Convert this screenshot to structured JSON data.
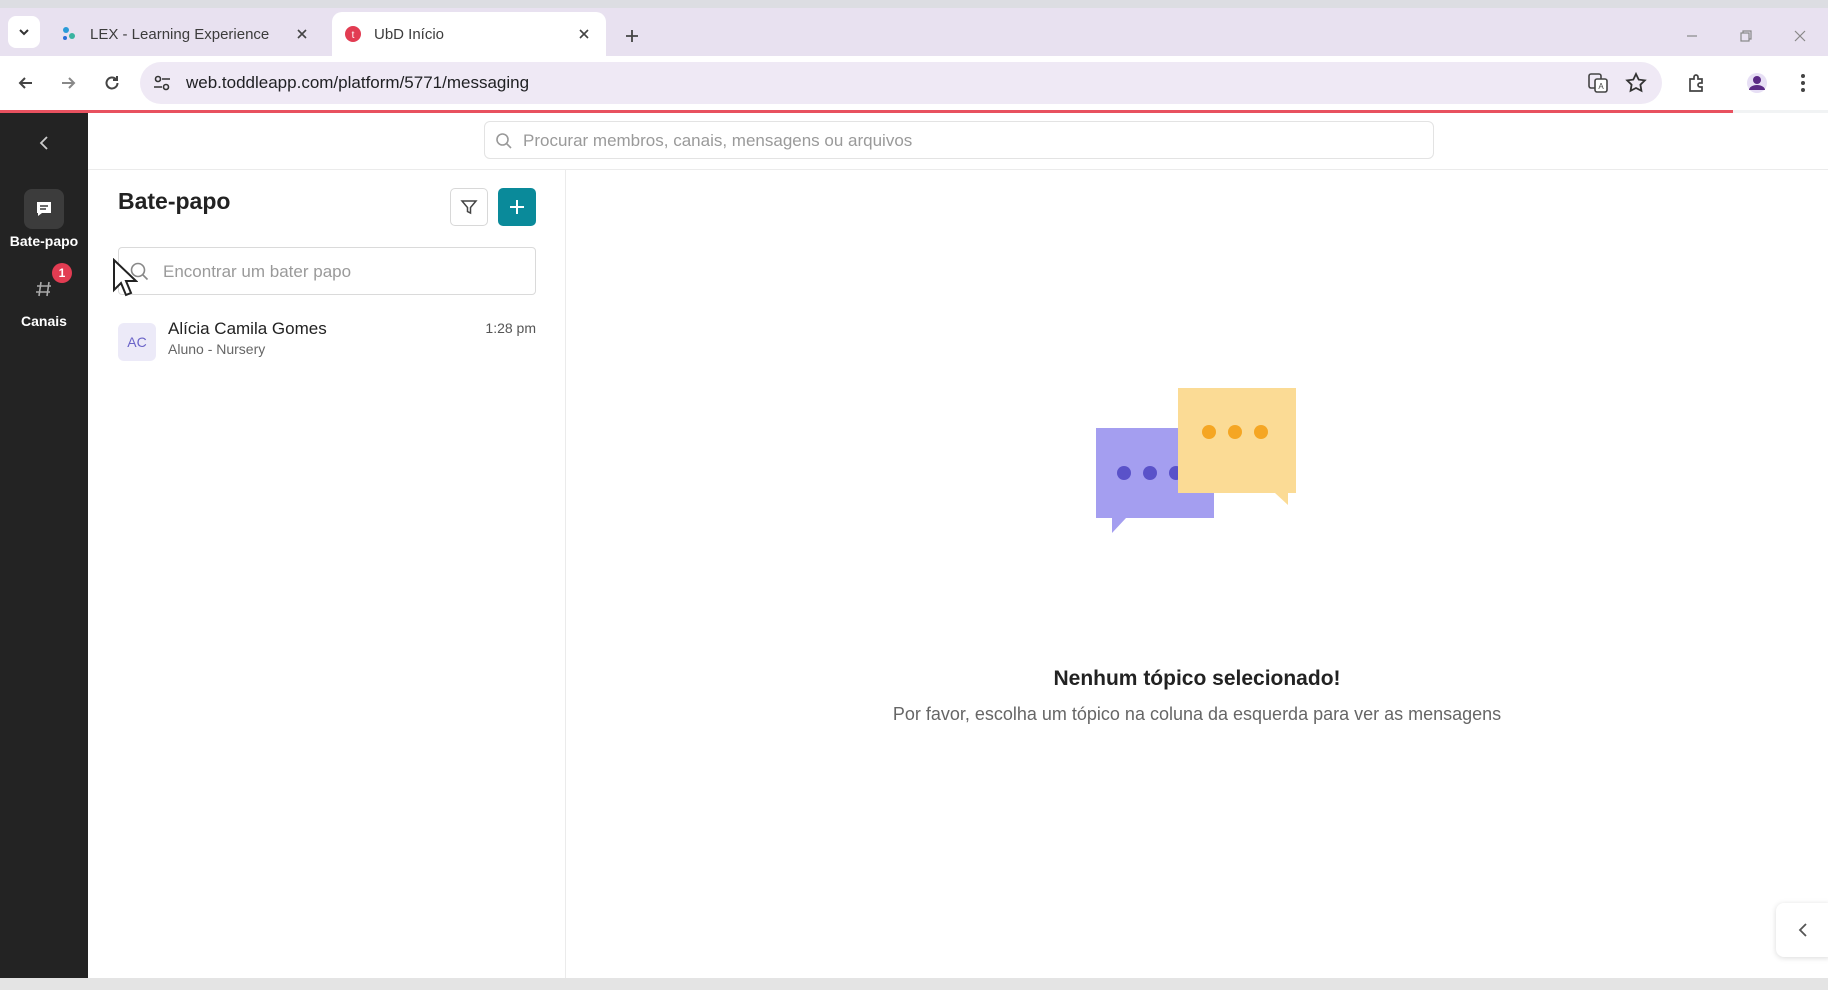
{
  "browser": {
    "tabs": [
      {
        "title": "LEX - Learning Experience",
        "active": false
      },
      {
        "title": "UbD Início",
        "active": true
      }
    ],
    "url": "web.toddleapp.com/platform/5771/messaging"
  },
  "rail": {
    "items": [
      {
        "label": "Bate-papo",
        "icon": "chat-icon",
        "active": true
      },
      {
        "label": "Canais",
        "icon": "hash-icon",
        "badge": "1"
      }
    ]
  },
  "global_search": {
    "placeholder": "Procurar membros, canais, mensagens ou arquivos"
  },
  "chat_panel": {
    "title": "Bate-papo",
    "search_placeholder": "Encontrar um bater papo",
    "conversations": [
      {
        "initials": "AC",
        "name": "Alícia Camila Gomes",
        "subtitle": "Aluno - Nursery",
        "time": "1:28 pm"
      }
    ]
  },
  "empty_state": {
    "title": "Nenhum tópico selecionado!",
    "description": "Por favor, escolha um tópico na coluna da esquerda para ver as mensagens"
  },
  "colors": {
    "accent": "#0a8a9a",
    "rail_bg": "#232323",
    "badge": "#e23c52",
    "bubble_purple": "#a49ef0",
    "bubble_yellow": "#fbdb95"
  }
}
